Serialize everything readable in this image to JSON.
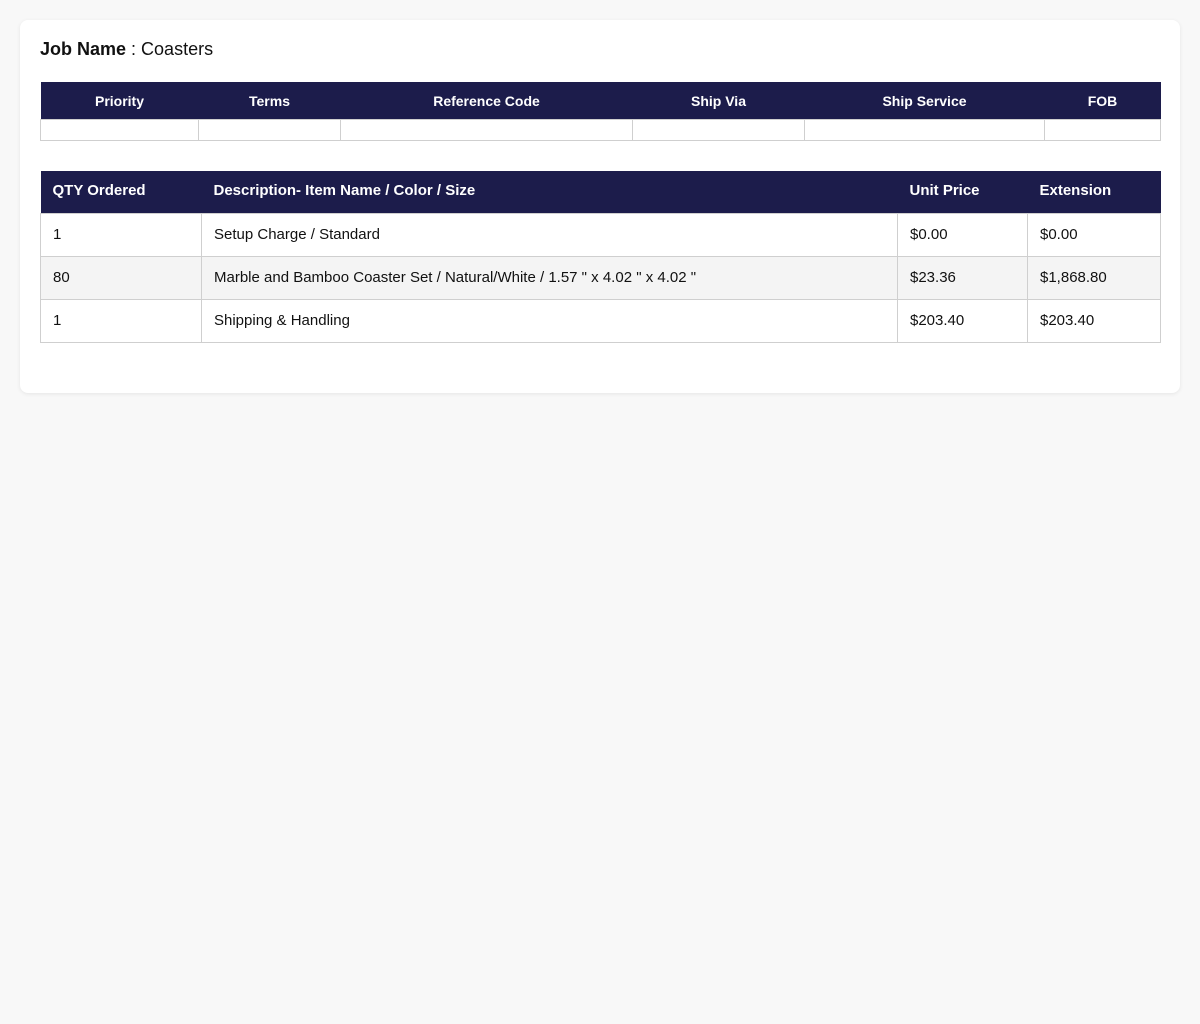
{
  "colors": {
    "header_bg": "#1c1c4b",
    "header_text": "#ffffff",
    "page_bg": "#f8f8f8",
    "card_bg": "#ffffff",
    "alt_row_bg": "#f4f4f4"
  },
  "job": {
    "label": "Job Name",
    "separator": " : ",
    "value": "Coasters"
  },
  "order_info": {
    "headers": [
      "Priority",
      "Terms",
      "Reference Code",
      "Ship Via",
      "Ship Service",
      "FOB"
    ],
    "values": [
      "",
      "",
      "",
      "",
      "",
      ""
    ]
  },
  "line_items": {
    "headers": [
      "QTY Ordered",
      "Description- Item Name / Color / Size",
      "Unit Price",
      "Extension"
    ],
    "rows": [
      {
        "qty": "1",
        "description": "Setup Charge / Standard",
        "unit_price": "$0.00",
        "extension": "$0.00"
      },
      {
        "qty": "80",
        "description": "Marble and Bamboo Coaster Set / Natural/White / 1.57 \" x 4.02 \" x 4.02 \"",
        "unit_price": "$23.36",
        "extension": "$1,868.80"
      },
      {
        "qty": "1",
        "description": "Shipping & Handling",
        "unit_price": "$203.40",
        "extension": "$203.40"
      }
    ]
  }
}
